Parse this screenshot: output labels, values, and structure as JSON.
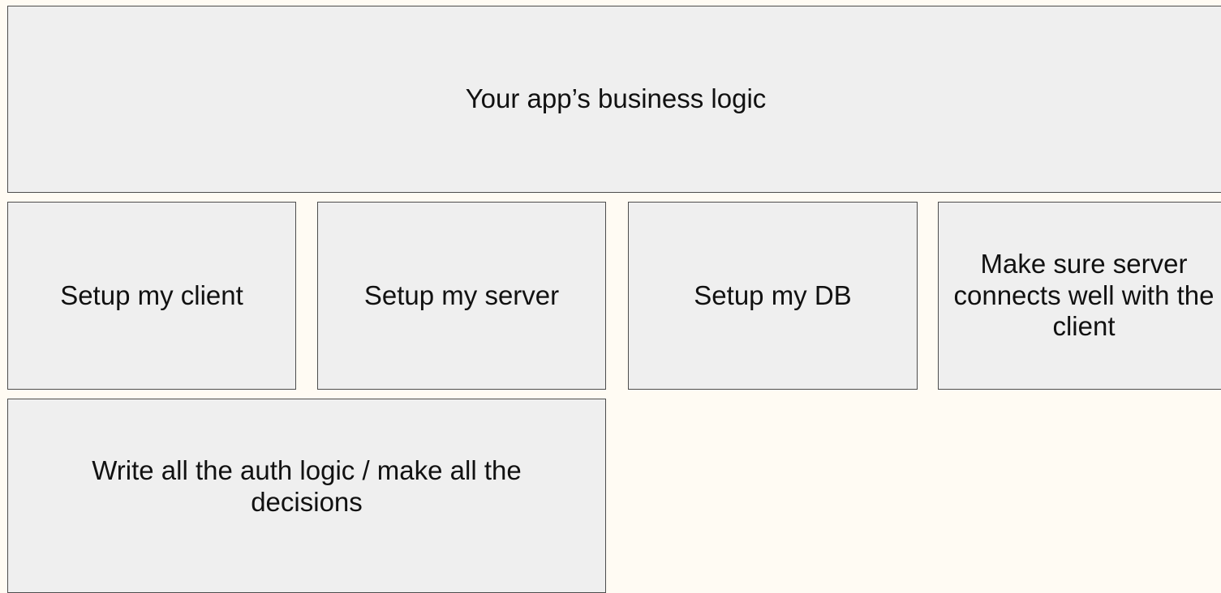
{
  "diagram": {
    "top_block": {
      "label": "Your app’s business logic"
    },
    "middle_row": [
      {
        "label": "Setup my client"
      },
      {
        "label": "Setup my server"
      },
      {
        "label": "Setup my DB"
      },
      {
        "label": "Make sure server connects well with the client"
      }
    ],
    "bottom_block": {
      "label": "Write all the auth logic / make all the decisions"
    }
  },
  "colors": {
    "background": "#fffbf3",
    "box_fill": "#efefef",
    "box_border": "#4d4d4d",
    "text": "#111111"
  }
}
